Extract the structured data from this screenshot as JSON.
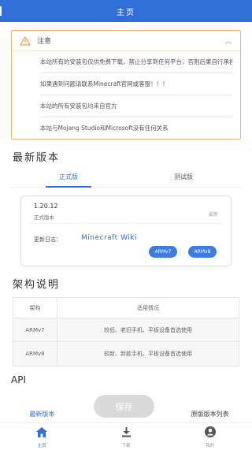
{
  "header": {
    "title": "主页"
  },
  "notice": {
    "title": "注意",
    "items": [
      "本站所有的安装包仅供免费下载，禁止分享到任何平台，否则后果自行承担！！！",
      "如果遇到问题请联系Minecraft官网或客服！！！",
      "本站的所有安装包均来自官方",
      "本站与Mojang Studio和Microsoft没有任何关系"
    ]
  },
  "latest": {
    "title": "最新版本",
    "tabs": [
      "正式版",
      "测试版"
    ],
    "card": {
      "version": "1.20.12",
      "subtitle": "正式版本",
      "tag": "最新",
      "log_label": "更新日志：",
      "log_link": "Minecraft Wiki",
      "buttons": [
        "ARMv7",
        "ARMv8"
      ]
    }
  },
  "arch": {
    "title": "架构说明",
    "headers": [
      "架构",
      "适用情况"
    ],
    "rows": [
      [
        "ARMv7",
        "较低、老旧手机、平板设备首选使用"
      ],
      [
        "ARMv8",
        "较新、新款手机、平板设备首选使用"
      ]
    ]
  },
  "api": {
    "title": "API"
  },
  "save_button": "保存",
  "links": [
    "最新版本",
    "历史版本",
    "原版版本列表"
  ],
  "bottom_nav": [
    {
      "label": "主页",
      "icon": "home-icon"
    },
    {
      "label": "下载",
      "icon": "download-icon"
    },
    {
      "label": "我的",
      "icon": "user-icon"
    }
  ],
  "colors": {
    "primary": "#2f6fd6",
    "warning_border": "#f0b36a"
  }
}
